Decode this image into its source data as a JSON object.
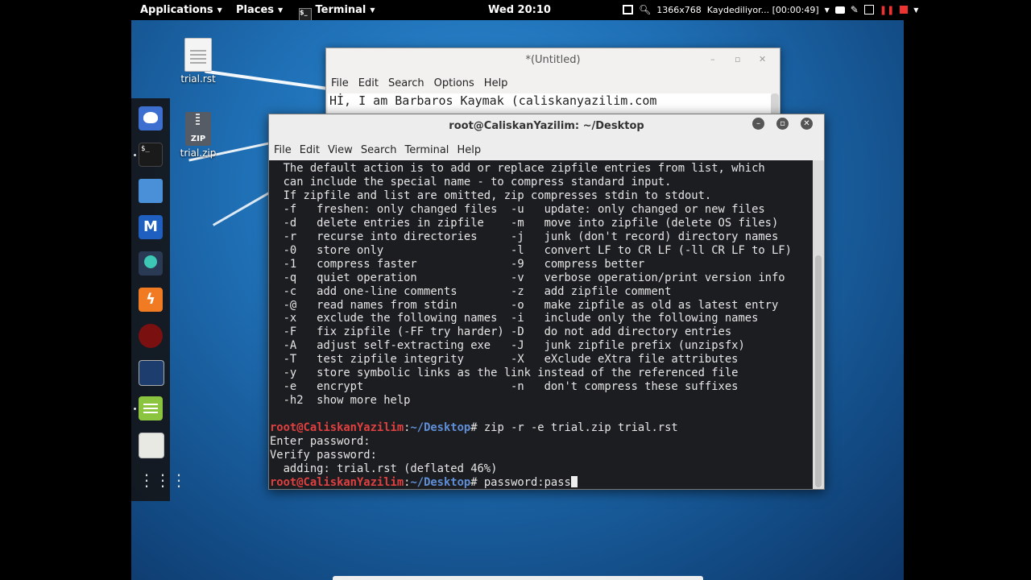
{
  "topbar": {
    "applications": "Applications",
    "places": "Places",
    "terminal": "Terminal",
    "clock": "Wed 20:10",
    "resolution": "1366x768",
    "recording": "Kaydediliyor... [00:00:49]"
  },
  "desktop_icons": [
    {
      "label": "trial.rst",
      "icon": "text-file-icon"
    },
    {
      "label": "trial.zip",
      "icon": "zip-file-icon",
      "badge": "ZIP"
    }
  ],
  "dock": {
    "items": [
      "bird-icon",
      "terminal-icon",
      "folder-icon",
      "metasploit-icon",
      "armitage-icon",
      "burpsuite-icon",
      "faraday-icon",
      "hacking-tool-icon",
      "notes-icon",
      "calculator-icon",
      "app-grid-icon"
    ]
  },
  "gedit": {
    "title": "*(Untitled)",
    "menu": [
      "File",
      "Edit",
      "Search",
      "Options",
      "Help"
    ],
    "line1": "Hİ, I am Barbaros Kaymak (caliskanyazilim.com"
  },
  "terminal": {
    "title": "root@CaliskanYazilim: ~/Desktop",
    "menu": [
      "File",
      "Edit",
      "View",
      "Search",
      "Terminal",
      "Help"
    ],
    "help_lines": [
      "  The default action is to add or replace zipfile entries from list, which",
      "  can include the special name - to compress standard input.",
      "  If zipfile and list are omitted, zip compresses stdin to stdout.",
      "  -f   freshen: only changed files  -u   update: only changed or new files",
      "  -d   delete entries in zipfile    -m   move into zipfile (delete OS files)",
      "  -r   recurse into directories     -j   junk (don't record) directory names",
      "  -0   store only                   -l   convert LF to CR LF (-ll CR LF to LF)",
      "  -1   compress faster              -9   compress better",
      "  -q   quiet operation              -v   verbose operation/print version info",
      "  -c   add one-line comments        -z   add zipfile comment",
      "  -@   read names from stdin        -o   make zipfile as old as latest entry",
      "  -x   exclude the following names  -i   include only the following names",
      "  -F   fix zipfile (-FF try harder) -D   do not add directory entries",
      "  -A   adjust self-extracting exe   -J   junk zipfile prefix (unzipsfx)",
      "  -T   test zipfile integrity       -X   eXclude eXtra file attributes",
      "  -y   store symbolic links as the link instead of the referenced file",
      "  -e   encrypt                      -n   don't compress these suffixes",
      "  -h2  show more help",
      ""
    ],
    "prompt_user": "root@CaliskanYazilim",
    "prompt_sep": ":",
    "prompt_path": "~/Desktop",
    "prompt_end": "# ",
    "command1": "zip -r -e trial.zip trial.rst",
    "out1": "Enter password:",
    "out2": "Verify password:",
    "out3": "  adding: trial.rst (deflated 46%)",
    "command2": "password:pass"
  }
}
